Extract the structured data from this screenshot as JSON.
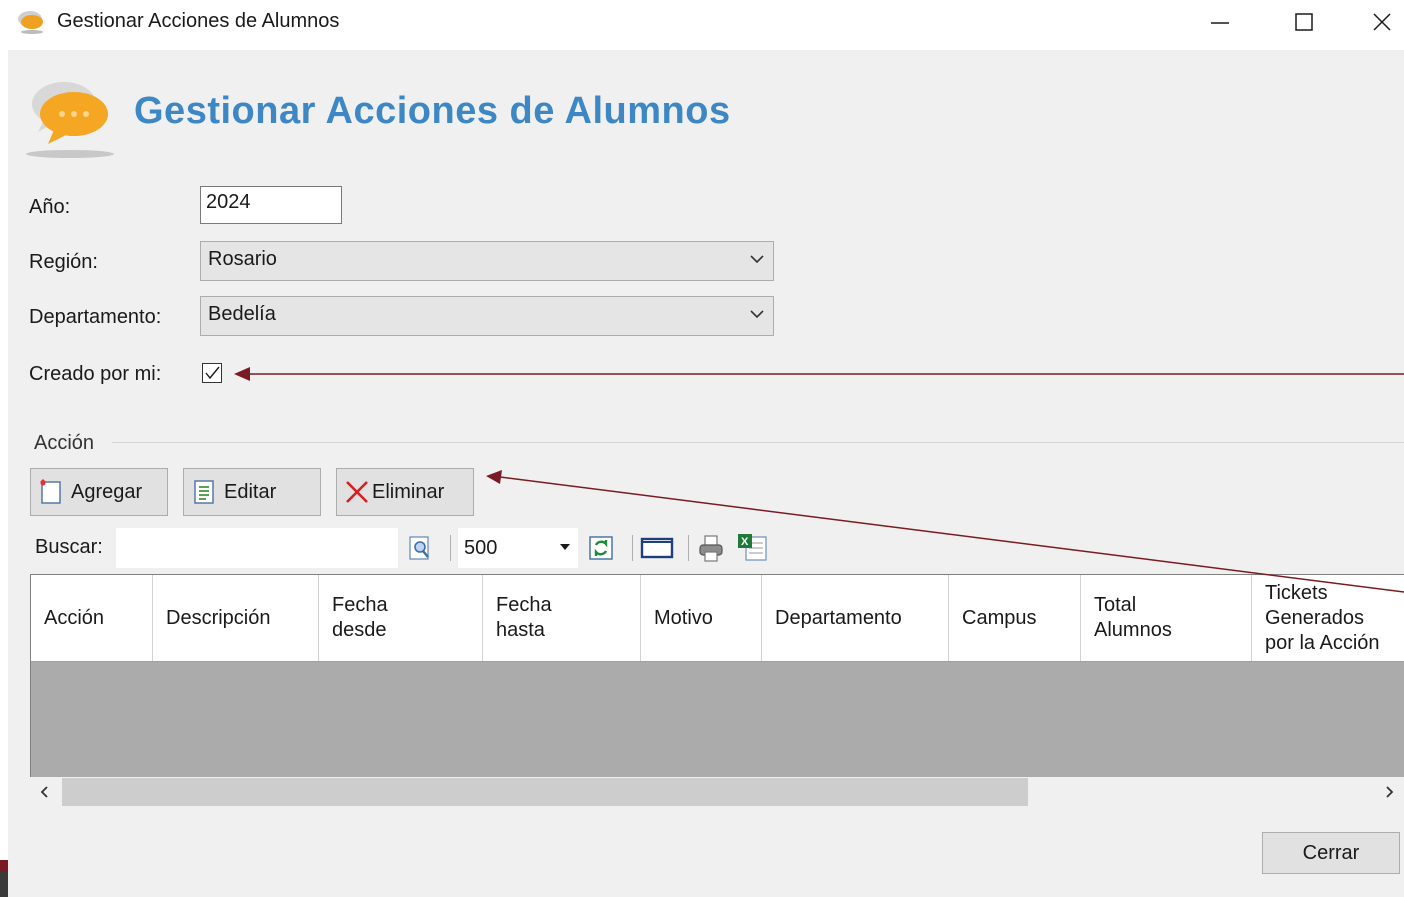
{
  "window": {
    "title": "Gestionar Acciones de Alumnos",
    "icon": "chat-bubble-icon"
  },
  "header": {
    "title": "Gestionar Acciones de Alumnos",
    "icon": "chat-bubbles-icon"
  },
  "form": {
    "anio_label": "Año:",
    "anio_value": "2024",
    "region_label": "Región:",
    "region_value": "Rosario",
    "departamento_label": "Departamento:",
    "departamento_value": "Bedelía",
    "creado_label": "Creado por mi:",
    "creado_checked": true
  },
  "group": {
    "title": "Acción"
  },
  "buttons": {
    "agregar": "Agregar",
    "editar": "Editar",
    "eliminar": "Eliminar",
    "cerrar": "Cerrar"
  },
  "toolbar": {
    "search_label": "Buscar:",
    "search_value": "",
    "page_size": "500"
  },
  "grid": {
    "columns": [
      "Acción",
      "Descripción",
      "Fecha\ndesde",
      "Fecha\nhasta",
      "Motivo",
      "Departamento",
      "Campus",
      "Total\nAlumnos",
      "Tickets\nGenerados\npor la Acción"
    ],
    "rows": []
  },
  "colors": {
    "title_blue": "#3d88c4",
    "annotation_arrow": "#7a1a22",
    "grid_empty": "#ababab"
  }
}
